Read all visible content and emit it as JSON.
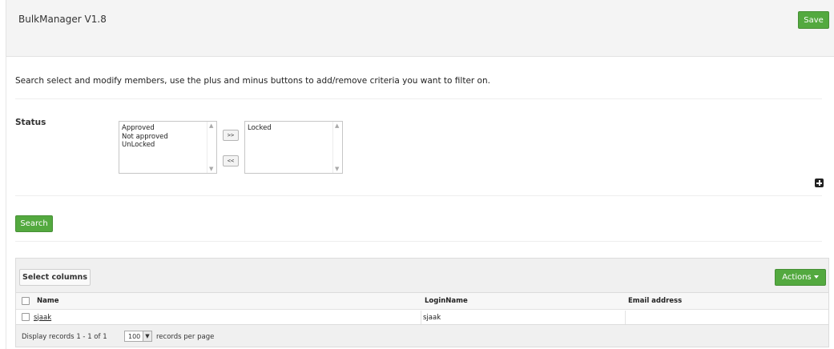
{
  "header": {
    "title": "BulkManager V1.8",
    "save_label": "Save"
  },
  "intro_text": "Search select and modify members, use the plus and minus buttons to add/remove criteria you want to filter on.",
  "criteria": {
    "status_label": "Status",
    "available": [
      "Approved",
      "Not approved",
      "UnLocked"
    ],
    "selected": [
      "Locked"
    ],
    "add_label": ">>",
    "remove_label": "<<"
  },
  "search_label": "Search",
  "grid": {
    "select_columns_label": "Select columns",
    "actions_label": "Actions",
    "columns": [
      "Name",
      "LoginName",
      "Email address"
    ],
    "rows": [
      {
        "name": "sjaak",
        "login": "sjaak",
        "email": ""
      }
    ],
    "footer": {
      "display_text": "Display records 1 - 1 of 1",
      "per_page_value": "100",
      "per_page_label": "records per page"
    }
  },
  "colors": {
    "accent_green": "#53a93f"
  },
  "icons": {
    "add_criteria": "plus-square-icon"
  }
}
